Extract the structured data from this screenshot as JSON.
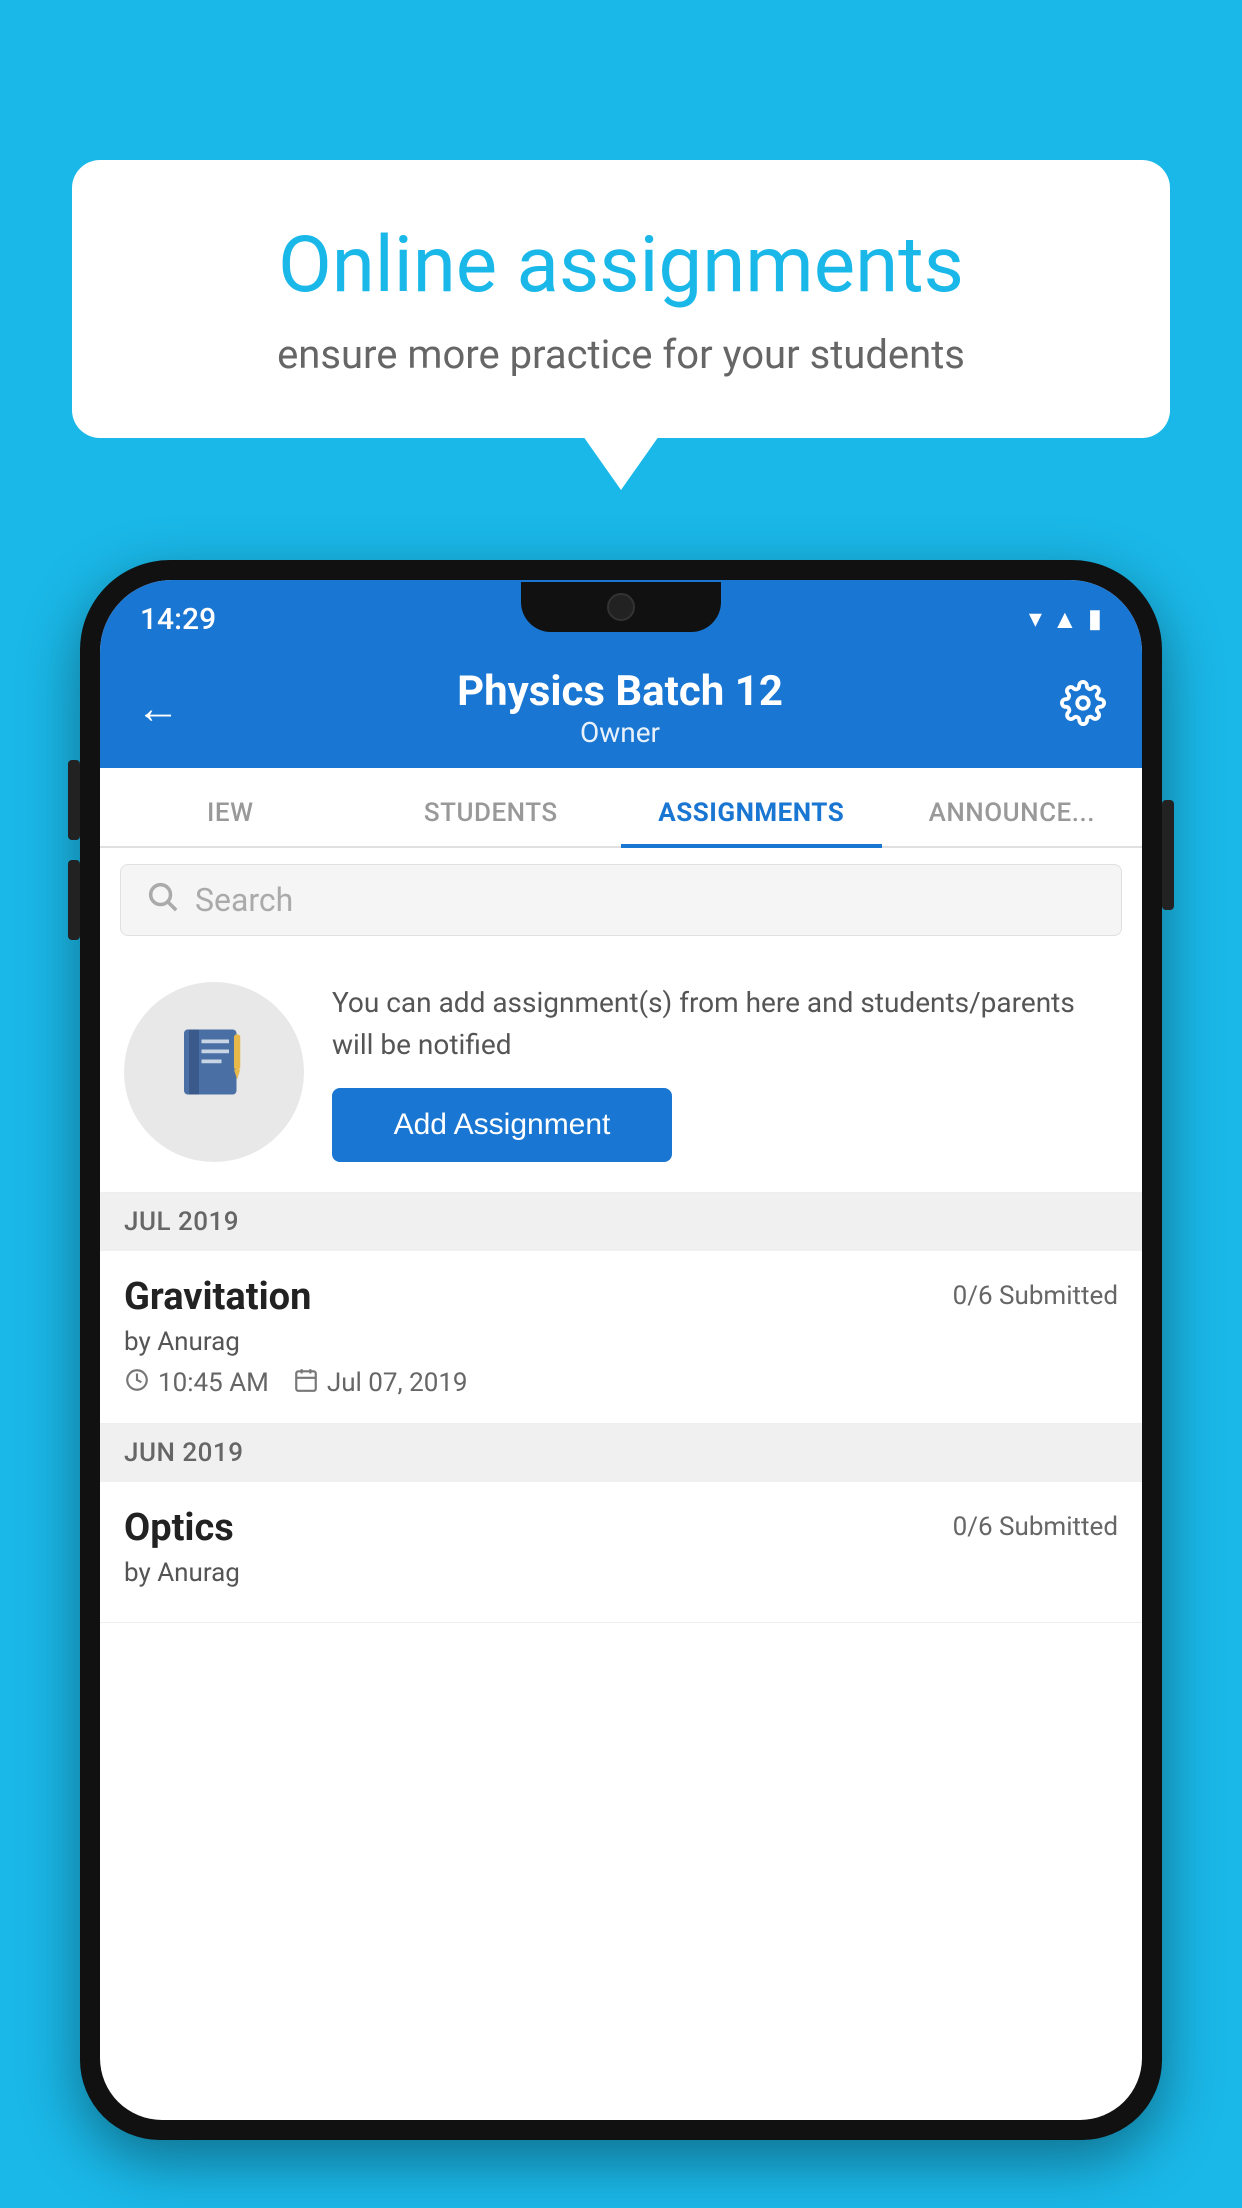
{
  "background": {
    "color": "#1ab8e8"
  },
  "speech_bubble": {
    "title": "Online assignments",
    "subtitle": "ensure more practice for your students"
  },
  "status_bar": {
    "time": "14:29",
    "icons": [
      "wifi",
      "signal",
      "battery"
    ]
  },
  "app_bar": {
    "back_label": "←",
    "title": "Physics Batch 12",
    "subtitle": "Owner",
    "settings_label": "⚙"
  },
  "tabs": [
    {
      "label": "IEW",
      "active": false
    },
    {
      "label": "STUDENTS",
      "active": false
    },
    {
      "label": "ASSIGNMENTS",
      "active": true
    },
    {
      "label": "ANNOUNCEMENTS",
      "active": false
    }
  ],
  "search": {
    "placeholder": "Search"
  },
  "info_section": {
    "description": "You can add assignment(s) from here and students/parents will be notified",
    "button_label": "Add Assignment"
  },
  "month_sections": [
    {
      "month_label": "JUL 2019",
      "assignments": [
        {
          "name": "Gravitation",
          "submitted": "0/6 Submitted",
          "by": "by Anurag",
          "time": "10:45 AM",
          "date": "Jul 07, 2019"
        }
      ]
    },
    {
      "month_label": "JUN 2019",
      "assignments": [
        {
          "name": "Optics",
          "submitted": "0/6 Submitted",
          "by": "by Anurag",
          "time": "",
          "date": ""
        }
      ]
    }
  ]
}
